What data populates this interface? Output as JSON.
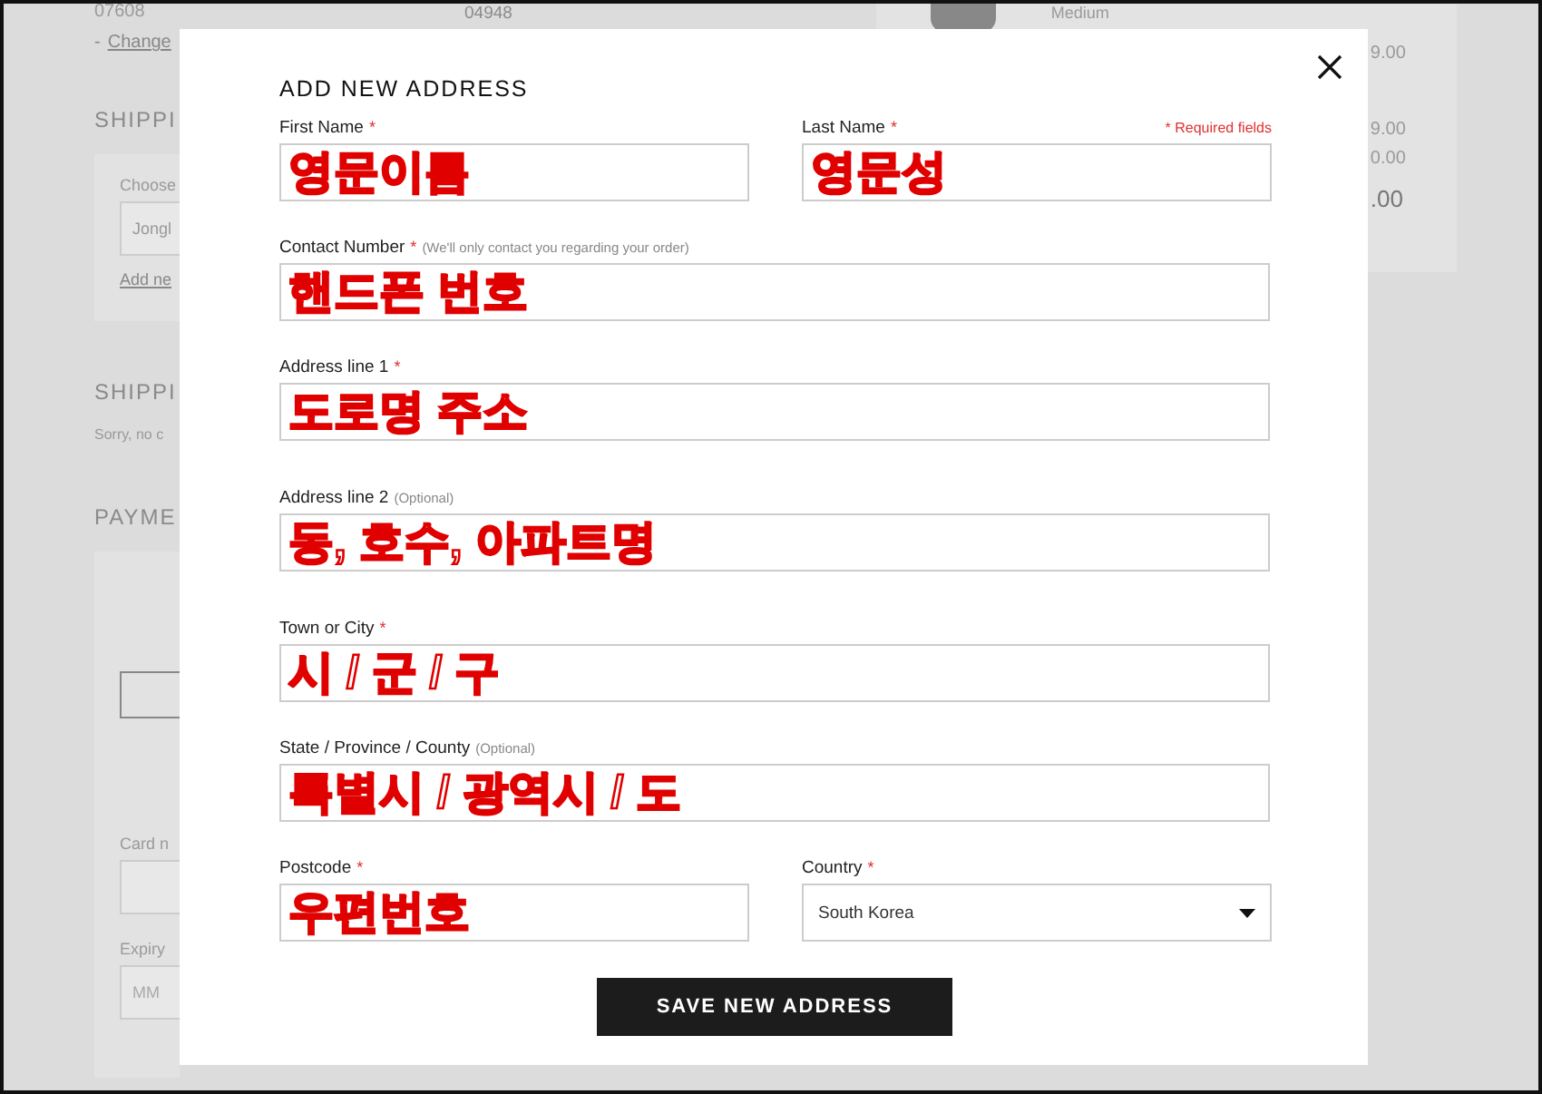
{
  "background": {
    "postcodes": [
      "07608",
      "04948"
    ],
    "change_bullet": "-",
    "change_link": "Change",
    "headings": [
      "SHIPPI",
      "SHIPPI",
      "PAYME"
    ],
    "address_panel": {
      "label": "Choose",
      "select_value": "Jongl",
      "add_link": "Add ne"
    },
    "shipping_note": "Sorry, no c",
    "payment_panel": {
      "card_label": "Card n",
      "expiry_label": "Expiry",
      "expiry_placeholder": "MM"
    },
    "order_item": {
      "size": "Medium"
    },
    "totals": [
      "9.00",
      "9.00",
      "0.00",
      ".00"
    ]
  },
  "modal": {
    "title": "ADD NEW ADDRESS",
    "required_mark": "*",
    "required_note": "* Required fields",
    "rows": [
      [
        {
          "label": "First Name",
          "required": true,
          "kind": "text",
          "value": "영문이름"
        },
        {
          "label": "Last Name",
          "required": true,
          "kind": "text",
          "value": "영문성"
        }
      ],
      [
        {
          "label": "Contact Number",
          "required": true,
          "note": "(We'll only contact you regarding your order)",
          "kind": "text",
          "value": "핸드폰 번호"
        }
      ],
      [
        {
          "label": "Address line 1",
          "required": true,
          "kind": "text",
          "value": "도로명 주소"
        }
      ],
      [
        {
          "label": "Address line 2",
          "required": false,
          "note": "(Optional)",
          "kind": "text",
          "value": "동, 호수, 아파트명"
        }
      ],
      [
        {
          "label": "Town or City",
          "required": true,
          "kind": "text",
          "value": "시 / 군 / 구"
        }
      ],
      [
        {
          "label": "State / Province / County",
          "required": false,
          "note": "(Optional)",
          "kind": "text",
          "value": "특별시 / 광역시 / 도"
        }
      ],
      [
        {
          "label": "Postcode",
          "required": true,
          "kind": "text",
          "value": "우편번호"
        },
        {
          "label": "Country",
          "required": true,
          "kind": "select",
          "value": "South Korea"
        }
      ]
    ],
    "button": "SAVE NEW ADDRESS"
  }
}
